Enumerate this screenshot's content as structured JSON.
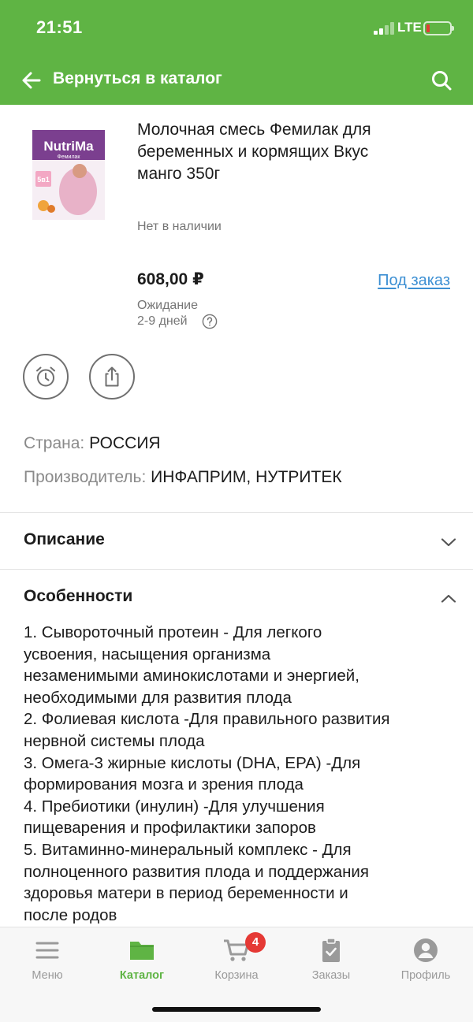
{
  "status_bar": {
    "time": "21:51",
    "network": "LTE",
    "battery_level": 0.1
  },
  "header": {
    "back_label": "Вернуться в каталог",
    "back_icon": "arrow-left-icon",
    "search_icon": "search-icon",
    "background": "#5fb444"
  },
  "product": {
    "image_brand": "NutriMa",
    "image_subbrand": "Фемилак",
    "image_badge": "5в1",
    "title_lines": [
      "Молочная смесь Фемилак для",
      "беременных и кормящих Вкус",
      "манго 350г"
    ],
    "stock": "Нет в наличии",
    "price": "608,00 ₽",
    "order_label": "Под заказ",
    "wait_label": "Ожидание",
    "wait_days": "2-9 дней",
    "help_icon": "question-circle-icon",
    "alarm_icon": "alarm-clock-icon",
    "share_icon": "share-icon",
    "country_key": "Страна:",
    "country_value": "РОССИЯ",
    "maker_key": "Производитель:",
    "maker_value": "ИНФАПРИМ, НУТРИТЕК"
  },
  "sections": {
    "description": "Описание",
    "features": "Особенности",
    "features_lines": [
      "1. Сывороточный протеин - Для легкого",
      "усвоения, насыщения организма",
      "незаменимыми аминокислотами и энергией,",
      "необходимыми для развития плода",
      "2. Фолиевая кислота -Для правильного развития",
      "нервной системы плода",
      "3. Омега-3 жирные кислоты (DHA, EPA) -Для",
      "формирования мозга и зрения плода",
      "4. Пребиотики (инулин) -Для улучшения",
      "пищеварения и профилактики запоров",
      "5. Витаминно-минеральный комплекс - Для",
      "полноценного развития плода и поддержания",
      "здоровья матери в период беременности и",
      "после родов"
    ]
  },
  "tabbar": {
    "items": [
      {
        "label": "Меню",
        "icon": "menu-icon"
      },
      {
        "label": "Каталог",
        "icon": "folder-icon"
      },
      {
        "label": "Корзина",
        "icon": "cart-icon"
      },
      {
        "label": "Заказы",
        "icon": "clipboard-icon"
      },
      {
        "label": "Профиль",
        "icon": "profile-icon"
      }
    ],
    "active": "Каталог",
    "cart_badge": "4",
    "accent": "#5fb444"
  }
}
